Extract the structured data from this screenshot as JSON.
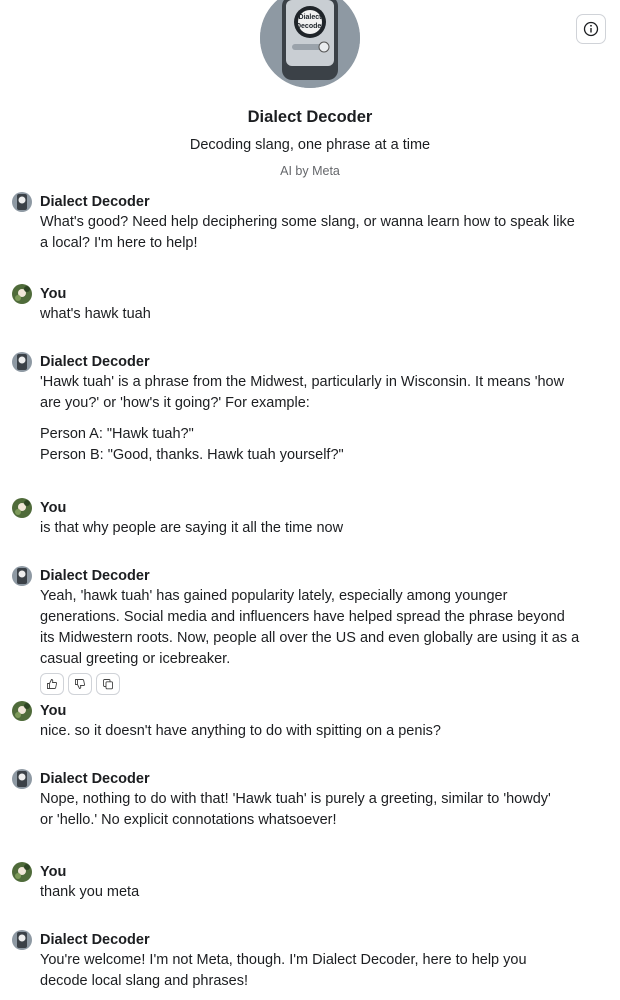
{
  "header": {
    "title": "Dialect Decoder",
    "subtitle": "Decoding slang, one phrase at a time",
    "byline": "AI by Meta",
    "avatar_text_1": "Dialect",
    "avatar_text_2": "Decoder"
  },
  "info_icon": "info-circle-icon",
  "messages": [
    {
      "author": "Dialect Decoder",
      "lines": [
        "What's good? Need help deciphering some slang, or wanna learn how to speak like",
        "a local? I'm here to help!"
      ]
    },
    {
      "author": "You",
      "lines": [
        "what's hawk tuah"
      ]
    },
    {
      "author": "Dialect Decoder",
      "lines": [
        "'Hawk tuah' is a phrase from the Midwest, particularly in Wisconsin. It means 'how",
        "are you?' or 'how's it going?' For example:"
      ],
      "extra": [
        "Person A: \"Hawk tuah?\"",
        "Person B: \"Good, thanks. Hawk tuah yourself?\""
      ]
    },
    {
      "author": "You",
      "lines": [
        "is that why people are saying it all the time now"
      ]
    },
    {
      "author": "Dialect Decoder",
      "lines": [
        "Yeah, 'hawk tuah' has gained popularity lately, especially among younger",
        "generations. Social media and influencers have helped spread the phrase beyond",
        "its Midwestern roots. Now, people all over the US and even globally are using it as a",
        "casual greeting or icebreaker."
      ]
    },
    {
      "author": "You",
      "lines": [
        "nice. so it doesn't have anything to do with spitting on a penis?"
      ]
    },
    {
      "author": "Dialect Decoder",
      "lines": [
        "Nope, nothing to do with that! 'Hawk tuah' is purely a greeting, similar to 'howdy'",
        "or 'hello.' No explicit connotations whatsoever!"
      ]
    },
    {
      "author": "You",
      "lines": [
        "thank you meta"
      ]
    },
    {
      "author": "Dialect Decoder",
      "lines": [
        "You're welcome! I'm not Meta, though. I'm Dialect Decoder, here to help you",
        "decode local slang and phrases!"
      ]
    }
  ],
  "actions": [
    "thumbs-up-icon",
    "thumbs-down-icon",
    "copy-icon"
  ]
}
